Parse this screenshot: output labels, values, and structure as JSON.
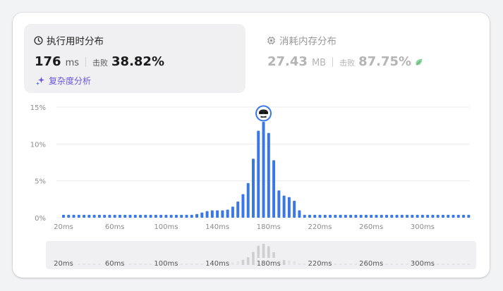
{
  "runtime": {
    "title": "执行用时分布",
    "value": "176",
    "unit": "ms",
    "beats_label": "击败",
    "beats_value": "38.82%",
    "analyze_label": "复杂度分析"
  },
  "memory": {
    "title": "消耗内存分布",
    "value": "27.43",
    "unit": "MB",
    "beats_label": "击败",
    "beats_value": "87.75%"
  },
  "chart_data": {
    "type": "bar",
    "title": "",
    "xlabel": "",
    "ylabel": "",
    "unit_x": "ms",
    "ylim": [
      0,
      15
    ],
    "y_ticks": [
      "0%",
      "5%",
      "10%",
      "15%"
    ],
    "x_ticks": [
      "20ms",
      "60ms",
      "100ms",
      "140ms",
      "180ms",
      "220ms",
      "260ms",
      "300ms"
    ],
    "x_tick_values": [
      20,
      60,
      100,
      140,
      180,
      220,
      260,
      300
    ],
    "x_start": 20,
    "x_step": 4,
    "values": [
      0.4,
      0.4,
      0.4,
      0.4,
      0.4,
      0.4,
      0.4,
      0.4,
      0.4,
      0.4,
      0.4,
      0.4,
      0.4,
      0.4,
      0.4,
      0.4,
      0.4,
      0.4,
      0.4,
      0.4,
      0.4,
      0.4,
      0.4,
      0.4,
      0.4,
      0.4,
      0.5,
      0.7,
      0.9,
      1.0,
      1.0,
      1.0,
      1.1,
      1.5,
      2.2,
      3.2,
      4.7,
      8.0,
      11.8,
      13.0,
      11.5,
      7.8,
      3.7,
      3.0,
      2.8,
      2.3,
      1.0,
      0.4,
      0.4,
      0.4,
      0.4,
      0.4,
      0.4,
      0.4,
      0.4,
      0.4,
      0.4,
      0.4,
      0.4,
      0.4,
      0.4,
      0.4,
      0.4,
      0.4,
      0.4,
      0.4,
      0.4,
      0.4,
      0.4,
      0.4,
      0.4,
      0.4,
      0.4,
      0.4,
      0.4,
      0.4,
      0.4,
      0.4,
      0.4,
      0.4
    ],
    "highlight_index": 39,
    "bar_color": "#3b78e7",
    "nav_bar_color": "#e4e4e6",
    "nav_highlight_color": "#cfcfd2",
    "grid": true
  }
}
